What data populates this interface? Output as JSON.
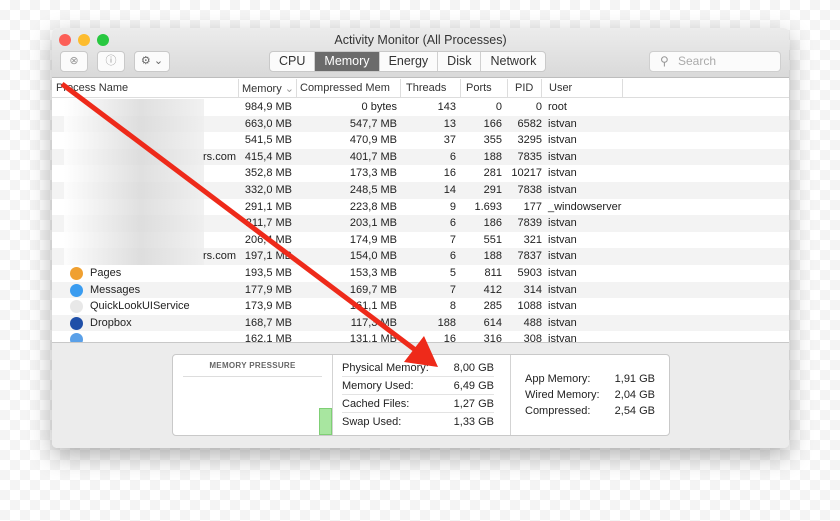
{
  "window": {
    "title": "Activity Monitor (All Processes)"
  },
  "toolbar": {
    "stop_icon": "x-circle-icon",
    "info_icon": "info-icon",
    "gear_icon": "gear-icon",
    "search_placeholder": "Search"
  },
  "tabs": [
    {
      "label": "CPU"
    },
    {
      "label": "Memory",
      "active": true
    },
    {
      "label": "Energy"
    },
    {
      "label": "Disk"
    },
    {
      "label": "Network"
    }
  ],
  "columns": [
    "Process Name",
    "Memory",
    "Compressed Mem",
    "Threads",
    "Ports",
    "PID",
    "User"
  ],
  "rows": [
    {
      "name": "",
      "memory": "984,9 MB",
      "compressed": "0 bytes",
      "threads": "143",
      "ports": "0",
      "pid": "0",
      "user": "root"
    },
    {
      "name": "",
      "memory": "663,0 MB",
      "compressed": "547,7 MB",
      "threads": "13",
      "ports": "166",
      "pid": "6582",
      "user": "istvan"
    },
    {
      "name": "",
      "memory": "541,5 MB",
      "compressed": "470,9 MB",
      "threads": "37",
      "ports": "355",
      "pid": "3295",
      "user": "istvan"
    },
    {
      "name": "rs.com",
      "memory": "415,4 MB",
      "compressed": "401,7 MB",
      "threads": "6",
      "ports": "188",
      "pid": "7835",
      "user": "istvan"
    },
    {
      "name": "",
      "memory": "352,8 MB",
      "compressed": "173,3 MB",
      "threads": "16",
      "ports": "281",
      "pid": "10217",
      "user": "istvan"
    },
    {
      "name": "",
      "memory": "332,0 MB",
      "compressed": "248,5 MB",
      "threads": "14",
      "ports": "291",
      "pid": "7838",
      "user": "istvan"
    },
    {
      "name": "",
      "memory": "291,1 MB",
      "compressed": "223,8 MB",
      "threads": "9",
      "ports": "1.693",
      "pid": "177",
      "user": "_windowserver"
    },
    {
      "name": "",
      "memory": "211,7 MB",
      "compressed": "203,1 MB",
      "threads": "6",
      "ports": "186",
      "pid": "7839",
      "user": "istvan"
    },
    {
      "name": "",
      "memory": "206,4 MB",
      "compressed": "174,9 MB",
      "threads": "7",
      "ports": "551",
      "pid": "321",
      "user": "istvan"
    },
    {
      "name": "rs.com",
      "memory": "197,1 MB",
      "compressed": "154,0 MB",
      "threads": "6",
      "ports": "188",
      "pid": "7837",
      "user": "istvan"
    },
    {
      "name": "Pages",
      "memory": "193,5 MB",
      "compressed": "153,3 MB",
      "threads": "5",
      "ports": "811",
      "pid": "5903",
      "user": "istvan",
      "icon_color": "#f0a030"
    },
    {
      "name": "Messages",
      "memory": "177,9 MB",
      "compressed": "169,7 MB",
      "threads": "7",
      "ports": "412",
      "pid": "314",
      "user": "istvan",
      "icon_color": "#3a9cf0"
    },
    {
      "name": "QuickLookUIService",
      "memory": "173,9 MB",
      "compressed": "161,1 MB",
      "threads": "8",
      "ports": "285",
      "pid": "1088",
      "user": "istvan",
      "icon_color": "#e8e8e8"
    },
    {
      "name": "Dropbox",
      "memory": "168,7 MB",
      "compressed": "117,3 MB",
      "threads": "188",
      "ports": "614",
      "pid": "488",
      "user": "istvan",
      "icon_color": "#1f4fa8"
    },
    {
      "name": "",
      "memory": "162,1 MB",
      "compressed": "131,1 MB",
      "threads": "16",
      "ports": "316",
      "pid": "308",
      "user": "istvan",
      "icon_color": "#5aa0e8"
    }
  ],
  "memory_pressure": {
    "label": "MEMORY PRESSURE",
    "level_percent": 40,
    "color": "#a8e6a0"
  },
  "stats": [
    {
      "label": "Physical Memory:",
      "value": "8,00 GB"
    },
    {
      "label": "Memory Used:",
      "value": "6,49 GB"
    },
    {
      "label": "Cached Files:",
      "value": "1,27 GB"
    },
    {
      "label": "Swap Used:",
      "value": "1,33 GB"
    }
  ],
  "details": [
    {
      "label": "App Memory:",
      "value": "1,91 GB"
    },
    {
      "label": "Wired Memory:",
      "value": "2,04 GB"
    },
    {
      "label": "Compressed:",
      "value": "2,54 GB"
    }
  ],
  "annotation": {
    "arrow_color": "#ee2a1a"
  }
}
